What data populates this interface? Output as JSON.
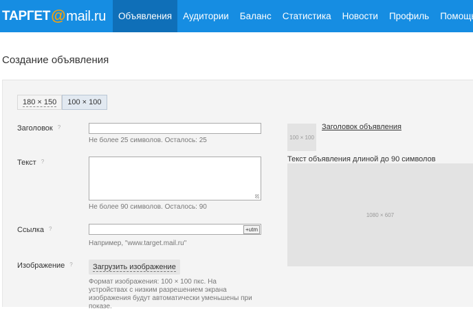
{
  "logo": {
    "prefix": "ТАРГЕТ",
    "at": "@",
    "domain": "mail.ru"
  },
  "nav": [
    {
      "label": "Объявления",
      "active": true
    },
    {
      "label": "Аудитории"
    },
    {
      "label": "Баланс"
    },
    {
      "label": "Статистика"
    },
    {
      "label": "Новости"
    },
    {
      "label": "Профиль"
    },
    {
      "label": "Помощь"
    }
  ],
  "page": {
    "title": "Создание объявления"
  },
  "size_tabs": [
    {
      "label": "180 × 150"
    },
    {
      "label": "100 × 100",
      "active": true
    }
  ],
  "form": {
    "help_symbol": "?",
    "title_label": "Заголовок",
    "title_value": "",
    "title_hint": "Не более 25 символов. Осталось: 25",
    "text_label": "Текст",
    "text_value": "",
    "text_hint": "Не более 90 символов. Осталось: 90",
    "link_label": "Ссылка",
    "link_value": "",
    "utm_button": "+utm",
    "link_hint": "Например, \"www.target.mail.ru\"",
    "image_label": "Изображение",
    "upload_button": "Загрузить изображение",
    "image_hint": "Формат изображения: 100 × 100 пкс. На устройствах с низким разрешением экрана изображения будут автоматически уменьшены при показе."
  },
  "preview": {
    "thumb_size": "100 × 100",
    "title": "Заголовок объявления",
    "text": "Текст объявления длиной до 90 символов",
    "big_size": "1080 × 607"
  },
  "colors": {
    "topbar": "#168de2",
    "nav_active": "#0f6fb8",
    "logo_at": "#f7a30a"
  }
}
